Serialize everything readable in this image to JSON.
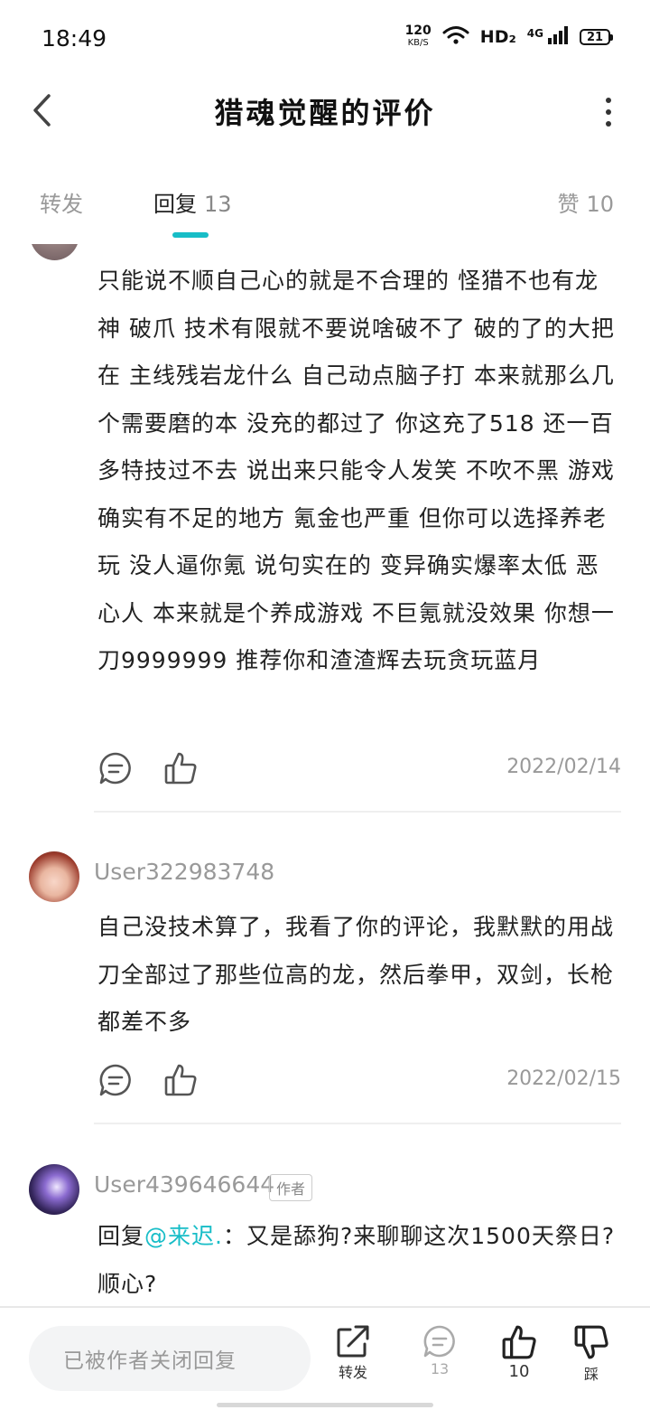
{
  "status_bar": {
    "time": "18:49",
    "net_speed_value": "120",
    "net_speed_unit": "KB/S",
    "hd_label": "HD₂",
    "signal_label": "4G",
    "battery": "21"
  },
  "header": {
    "title": "猎魂觉醒的评价",
    "back_icon": "chevron-left-icon",
    "more_icon": "more-vertical-icon"
  },
  "tabs": {
    "repost_label": "转发",
    "reply_label": "回复",
    "reply_count": "13",
    "like_label": "赞",
    "like_count": "10",
    "active": "reply",
    "accent_color": "#17bdc7"
  },
  "comments": [
    {
      "text": "只能说不顺自己心的就是不合理的 怪猎不也有龙神 破爪 技术有限就不要说啥破不了 破的了的大把在 主线残岩龙什么 自己动点脑子打 本来就那么几个需要磨的本 没充的都过了 你这充了518 还一百多特技过不去 说出来只能令人发笑 不吹不黑 游戏确实有不足的地方 氪金也严重 但你可以选择养老玩 没人逼你氪 说句实在的 变异确实爆率太低 恶心人 本来就是个养成游戏 不巨氪就没效果 你想一刀9999999 推荐你和渣渣辉去玩贪玩蓝月",
      "date": "2022/02/14"
    },
    {
      "user": "User322983748",
      "text": "自己没技术算了，我看了你的评论，我默默的用战刀全部过了那些位高的龙，然后拳甲，双剑，长枪都差不多",
      "date": "2022/02/15"
    },
    {
      "user": "User439646644",
      "badge": "作者",
      "reply_prefix": "回复",
      "mention": "@来迟.",
      "text": "：又是舔狗?来聊聊这次1500天祭日?顺心?"
    }
  ],
  "bottom_bar": {
    "closed_placeholder": "已被作者关闭回复",
    "repost_label": "转发",
    "reply_count": "13",
    "like_count": "10",
    "dislike_label": "踩"
  }
}
